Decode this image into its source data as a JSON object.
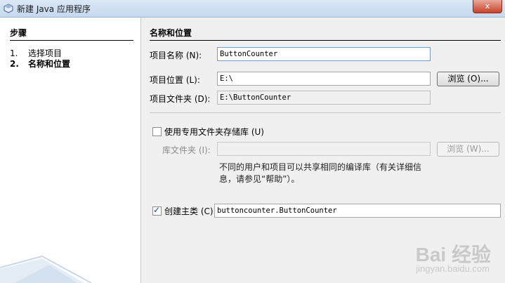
{
  "window": {
    "title": "新建 Java 应用程序",
    "close_label": "x"
  },
  "steps": {
    "header": "步骤",
    "items": [
      {
        "num": "1.",
        "label": "选择项目",
        "current": false
      },
      {
        "num": "2.",
        "label": "名称和位置",
        "current": true
      }
    ]
  },
  "main": {
    "section_title": "名称和位置",
    "project_name": {
      "label": "项目名称 (N):",
      "value": "ButtonCounter"
    },
    "project_location": {
      "label": "项目位置 (L):",
      "value": "E:\\",
      "browse_label": "浏览 (O)..."
    },
    "project_folder": {
      "label": "项目文件夹 (D):",
      "value": "E:\\ButtonCounter"
    },
    "use_dedicated_lib": {
      "label": "使用专用文件夹存储库 (U)",
      "checked": false
    },
    "lib_folder": {
      "label": "库文件夹 (I):",
      "value": "",
      "browse_label": "浏览 (W)..."
    },
    "hint_text": "不同的用户和项目可以共享相同的编译库（有关详细信息，请参见“帮助”）。",
    "create_main_class": {
      "label": "创建主类 (C)",
      "checked": true,
      "value": "buttoncounter.ButtonCounter"
    }
  },
  "watermark": {
    "text": "Bai 经验",
    "sub": "jingyan.baidu.com"
  }
}
